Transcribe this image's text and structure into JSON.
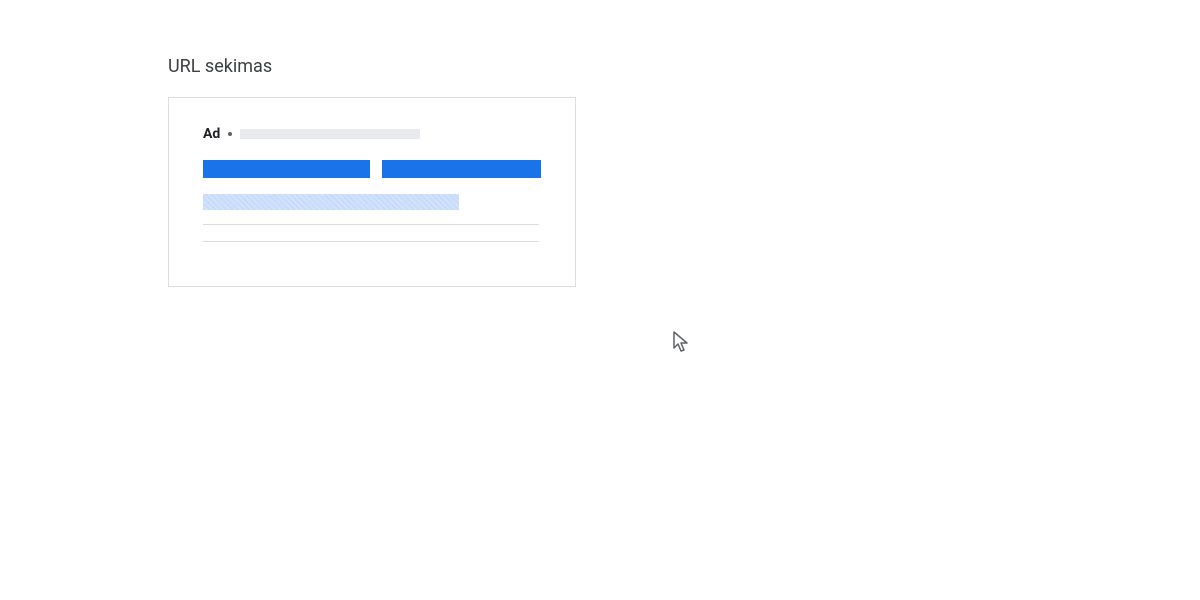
{
  "section": {
    "title": "URL sekimas"
  },
  "adPreview": {
    "label": "Ad"
  }
}
